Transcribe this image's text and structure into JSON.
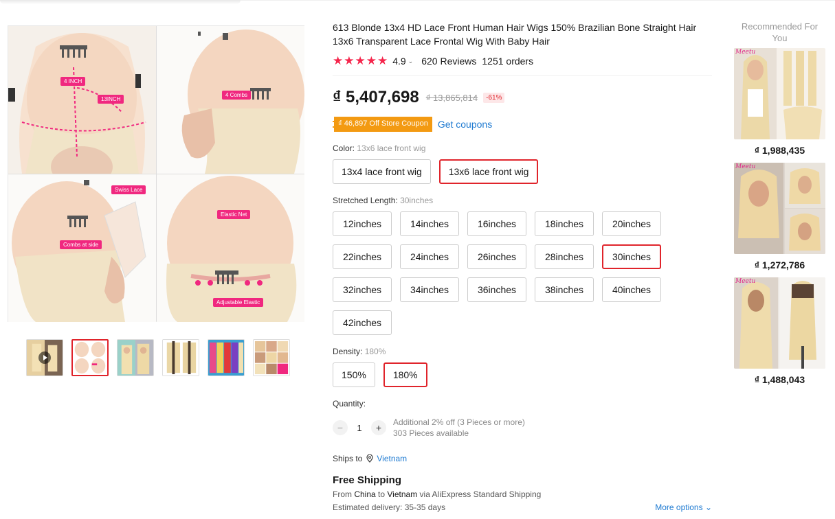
{
  "product": {
    "title": "613 Blonde 13x4 HD Lace Front Human Hair Wigs 150% Brazilian Bone Straight Hair 13x6 Transparent Lace Frontal Wig With Baby Hair",
    "stars": "★★★★★",
    "rating": "4.9",
    "reviews": "620 Reviews",
    "orders": "1251 orders",
    "price": "₫ 5,407,698",
    "original_price": "₫ 13,865,814",
    "discount": "-61%",
    "coupon": "₫ 46,897 Off Store Coupon",
    "get_coupons": "Get coupons"
  },
  "gallery": {
    "tags": {
      "four_inch": "4 INCH",
      "thirteen_inch": "13INCH",
      "four_combs": "4 Combs",
      "swiss_lace": "Swiss Lace",
      "combs_at_side": "Combs at side",
      "elastic_net": "Elastic Net",
      "adjustable_elastic": "Adjustable Elastic"
    }
  },
  "options": {
    "color": {
      "label": "Color: ",
      "selected": "13x6 lace front wig",
      "items": [
        "13x4 lace front wig",
        "13x6 lace front wig"
      ]
    },
    "length": {
      "label": "Stretched Length: ",
      "selected": "30inches",
      "items": [
        "12inches",
        "14inches",
        "16inches",
        "18inches",
        "20inches",
        "22inches",
        "24inches",
        "26inches",
        "28inches",
        "30inches",
        "32inches",
        "34inches",
        "36inches",
        "38inches",
        "40inches",
        "42inches"
      ]
    },
    "density": {
      "label": "Density: ",
      "selected": "180%",
      "items": [
        "150%",
        "180%"
      ]
    }
  },
  "quantity": {
    "label": "Quantity:",
    "minus": "−",
    "plus": "+",
    "value": "1",
    "note1": "Additional 2% off (3 Pieces or more)",
    "note2": "303 Pieces available"
  },
  "shipping": {
    "ships_to": "Ships to",
    "country": "Vietnam",
    "free": "Free Shipping",
    "from_prefix": "From ",
    "from": "China",
    "to_prefix": " to ",
    "to": "Vietnam",
    "via": " via AliExpress Standard Shipping",
    "estimated": "Estimated delivery: 35-35 days",
    "more_options": "More options ⌄"
  },
  "recommended": {
    "title": "Recommended For You",
    "items": [
      {
        "price": "₫ 1,988,435"
      },
      {
        "price": "₫ 1,272,786"
      },
      {
        "price": "₫ 1,488,043"
      }
    ]
  },
  "colors": {
    "accent_red": "#e0242b",
    "star_red": "#f5254b",
    "coupon_orange": "#f39a12",
    "link_blue": "#1e7ad1",
    "tag_pink": "#f0287f"
  }
}
